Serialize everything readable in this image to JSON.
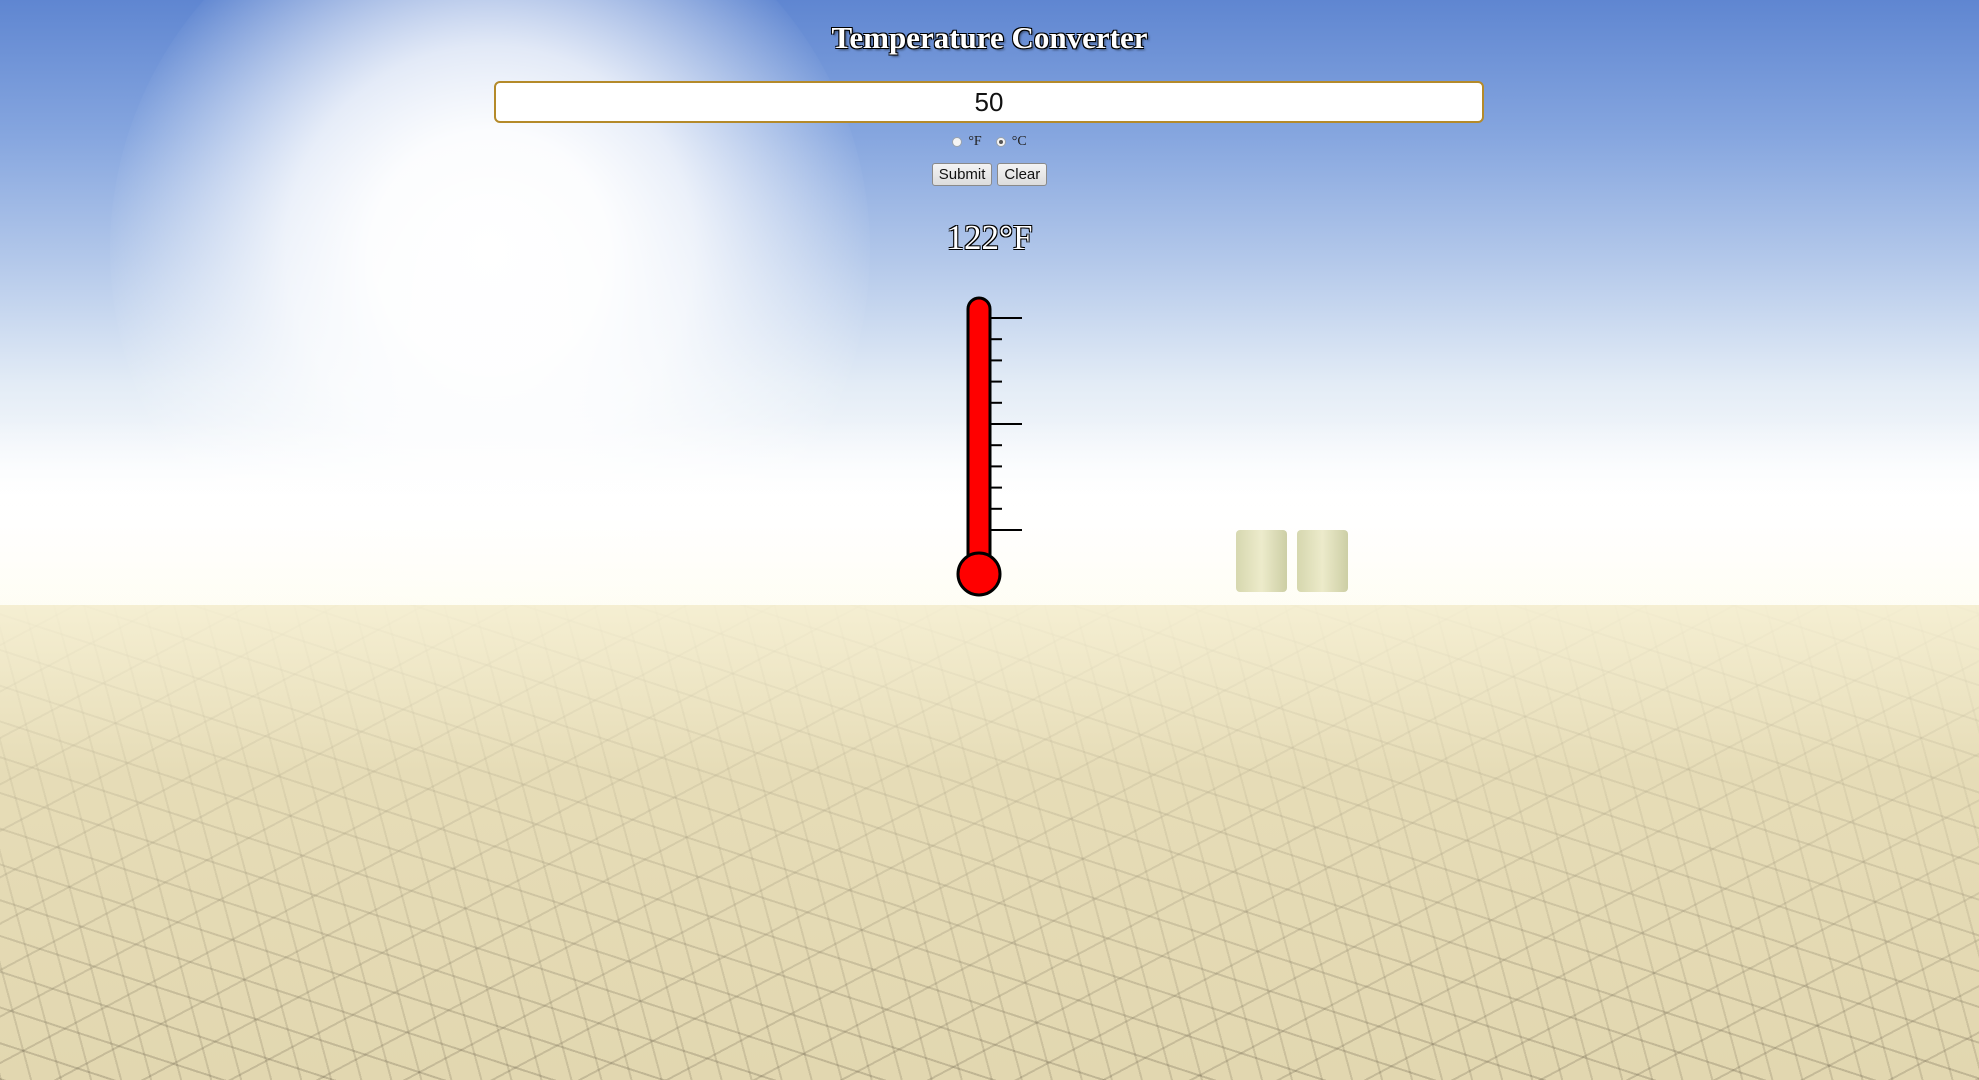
{
  "app": {
    "title": "Temperature Converter"
  },
  "input": {
    "value": "50",
    "placeholder": ""
  },
  "units": {
    "options": [
      {
        "label": "°F",
        "checked": false
      },
      {
        "label": "°C",
        "checked": true
      }
    ]
  },
  "actions": {
    "submit_label": "Submit",
    "clear_label": "Clear"
  },
  "result": {
    "text": "122°F"
  },
  "thermometer": {
    "fill_level": 1.0,
    "color": "#ff0000",
    "outline": "#000000"
  }
}
